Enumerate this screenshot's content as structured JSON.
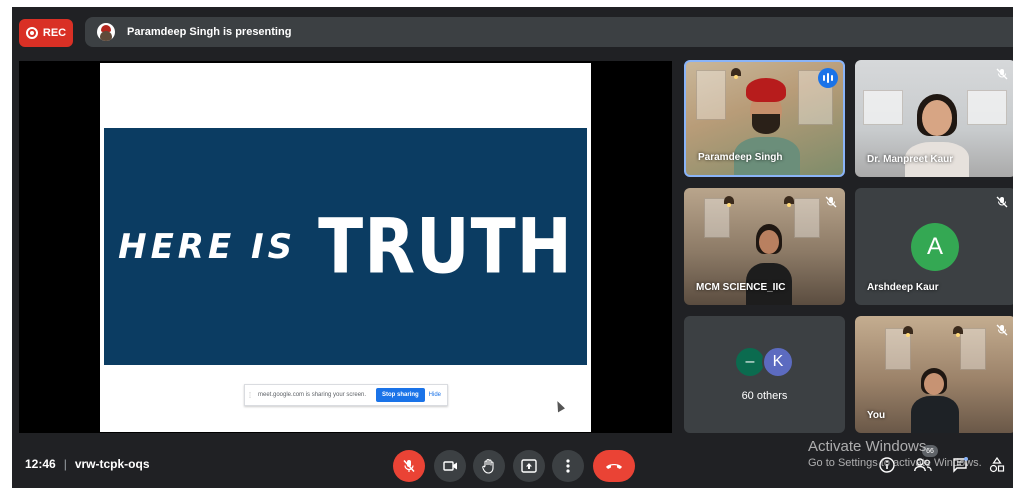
{
  "header": {
    "rec_label": "REC",
    "presenting_text": "Paramdeep Singh is presenting"
  },
  "presentation": {
    "slide_text_small": "HERE IS",
    "slide_text_large": "TRUTH",
    "share_bar": {
      "message": "meet.google.com is sharing your screen.",
      "stop_label": "Stop sharing",
      "hide_label": "Hide"
    }
  },
  "participants": [
    {
      "name": "Paramdeep Singh",
      "speaking": true
    },
    {
      "name": "Dr. Manpreet Kaur",
      "muted": true
    },
    {
      "name": "MCM SCIENCE_IIC",
      "muted": true
    },
    {
      "name": "Arshdeep Kaur",
      "initial": "A",
      "muted": true
    },
    {
      "others_label": "60 others",
      "avatar_1": "–",
      "avatar_2": "K"
    },
    {
      "name": "You",
      "muted": true
    }
  ],
  "footer": {
    "time": "12:46",
    "separator": "|",
    "meeting_code": "vrw-tcpk-oqs",
    "people_count": "66"
  },
  "watermark": {
    "line1": "Activate Windows",
    "line2": "Go to Settings to activate Windows."
  },
  "colors": {
    "background": "#202124",
    "tile": "#3c4043",
    "rec": "#d93025",
    "end_call": "#ea4335",
    "speaking_border": "#8ab4f8",
    "slide_banner": "#0b3c62",
    "avatar_a": "#34a853"
  }
}
